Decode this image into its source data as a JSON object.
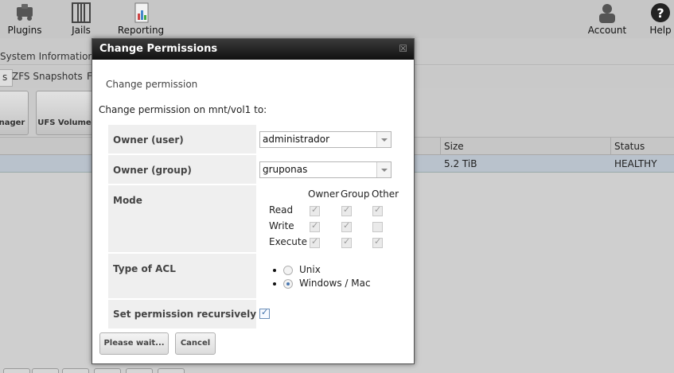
{
  "topbar": {
    "plugins_label": "Plugins",
    "jails_label": "Jails",
    "reporting_label": "Reporting",
    "account_label": "Account",
    "help_label": "Help"
  },
  "subbar": {
    "system_info": "System Information"
  },
  "tabs": [
    {
      "label": "s"
    },
    {
      "label": "ZFS Snapshots"
    },
    {
      "label": "F"
    }
  ],
  "toolbar_buttons": [
    {
      "label": "nager"
    },
    {
      "label": "UFS Volume"
    }
  ],
  "table": {
    "headers": {
      "size": "Size",
      "status": "Status"
    },
    "rows": [
      {
        "size": "5.2 TiB",
        "status": "HEALTHY"
      }
    ]
  },
  "dialog": {
    "title": "Change Permissions",
    "close": "☒",
    "heading": "Change permission",
    "subheading": "Change permission on mnt/vol1 to:",
    "owner_user_label": "Owner (user)",
    "owner_user_value": "administrador",
    "owner_group_label": "Owner (group)",
    "owner_group_value": "gruponas",
    "mode_label": "Mode",
    "mode_columns": [
      "Owner",
      "Group",
      "Other"
    ],
    "mode_rows": [
      {
        "label": "Read",
        "values": [
          true,
          true,
          true
        ]
      },
      {
        "label": "Write",
        "values": [
          true,
          true,
          false
        ]
      },
      {
        "label": "Execute",
        "values": [
          true,
          true,
          true
        ]
      }
    ],
    "acl_label": "Type of ACL",
    "acl_options": [
      {
        "label": "Unix",
        "selected": false
      },
      {
        "label": "Windows / Mac",
        "selected": true
      }
    ],
    "recursive_label": "Set permission recursively",
    "recursive_checked": true,
    "submit_label": "Please wait...",
    "cancel_label": "Cancel"
  }
}
